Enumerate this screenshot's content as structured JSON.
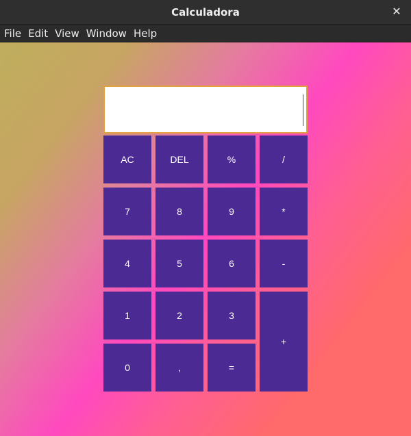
{
  "window": {
    "title": "Calculadora",
    "close_icon": "close-icon"
  },
  "menu": [
    "File",
    "Edit",
    "View",
    "Window",
    "Help"
  ],
  "display": {
    "value": ""
  },
  "buttons": {
    "ac": "AC",
    "del": "DEL",
    "percent": "%",
    "divide": "/",
    "seven": "7",
    "eight": "8",
    "nine": "9",
    "multiply": "*",
    "four": "4",
    "five": "5",
    "six": "6",
    "minus": "-",
    "one": "1",
    "two": "2",
    "three": "3",
    "plus": "+",
    "zero": "0",
    "comma": ",",
    "equals": "="
  },
  "colors": {
    "button_bg": "#4c2a93",
    "display_border": "#e2a23c"
  }
}
